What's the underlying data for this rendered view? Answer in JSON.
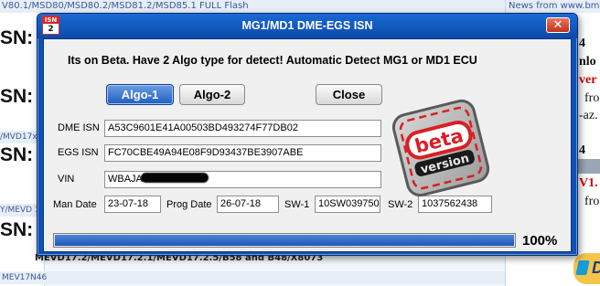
{
  "background": {
    "top_bar_text": "V80.1/MSD80/MSD80.2/MSD81.2/MSD85.1 FULL Flash",
    "news_header": "News from www.bmw",
    "big_labels": [
      "SN:",
      "SN:",
      "SN:",
      "SN:"
    ],
    "strip_texts": [
      "/MVD17xx",
      "Y/MEVD 1",
      "MEV17N46"
    ],
    "bottom_text": "MEVD17.2/MEVD17.2.1/MEVD17.2.5/B58 and B48/X8073",
    "right_fragments": [
      "4",
      "nlo",
      "ver",
      "fro",
      "-az.",
      "4",
      "nlo",
      "V1.",
      "fro"
    ],
    "paypal_text": "Do"
  },
  "dialog": {
    "app_icon_top": "ISN",
    "app_icon_bottom": "2",
    "title": "MG1/MD1 DME-EGS ISN",
    "close_glyph": "✕",
    "headline": "Its on Beta. Have 2 Algo type for detect! Automatic Detect MG1 or MD1 ECU",
    "buttons": {
      "algo1": "Algo-1",
      "algo2": "Algo-2",
      "close": "Close"
    },
    "fields": {
      "dme_isn_label": "DME ISN",
      "dme_isn_value": "A53C9601E41A00503BD493274F77DB02",
      "egs_isn_label": "EGS ISN",
      "egs_isn_value": "FC70CBE49A94E08F9D93437BE3907ABE",
      "vin_label": "VIN",
      "vin_value": "WBAJA",
      "man_date_label": "Man Date",
      "man_date_value": "23-07-18",
      "prog_date_label": "Prog Date",
      "prog_date_value": "26-07-18",
      "sw1_label": "SW-1",
      "sw1_value": "10SW039750",
      "sw2_label": "SW-2",
      "sw2_value": "1037562438"
    },
    "progress": {
      "value": 100,
      "label": "100%"
    },
    "stamp": {
      "word1": "beta",
      "word2": "version",
      "colors": {
        "red": "#d91f26",
        "grey": "#8c8c8c"
      }
    }
  }
}
